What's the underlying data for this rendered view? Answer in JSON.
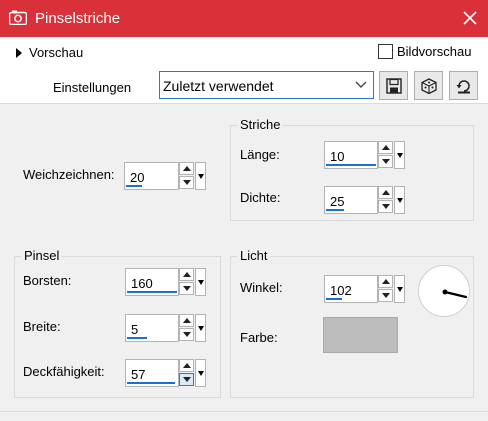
{
  "window": {
    "title": "Pinselstriche",
    "app_icon": "camera-icon",
    "close_icon": "close-icon",
    "accent_color": "#d9303a"
  },
  "preview": {
    "toggle_label": "Vorschau",
    "toggle_icon": "triangle-right-icon",
    "bildvorschau_label": "Bildvorschau",
    "bildvorschau_checked": false
  },
  "settings": {
    "label": "Einstellungen",
    "preset_value": "Zuletzt verwendet",
    "buttons": [
      "save-icon",
      "randomize-dice-icon",
      "reset-icon"
    ]
  },
  "general": {
    "weichzeichnen_label": "Weichzeichnen:",
    "weichzeichnen_value": "20"
  },
  "striche": {
    "title": "Striche",
    "laenge_label": "Länge:",
    "laenge_value": "10",
    "dichte_label": "Dichte:",
    "dichte_value": "25"
  },
  "pinsel": {
    "title": "Pinsel",
    "borsten_label": "Borsten:",
    "borsten_value": "160",
    "breite_label": "Breite:",
    "breite_value": "5",
    "deckfaehigkeit_label": "Deckfähigkeit:",
    "deckfaehigkeit_value": "57"
  },
  "licht": {
    "title": "Licht",
    "winkel_label": "Winkel:",
    "winkel_value": "102",
    "farbe_label": "Farbe:",
    "farbe_color": "#bdbdbd",
    "dial_icon": "angle-dial-icon"
  }
}
